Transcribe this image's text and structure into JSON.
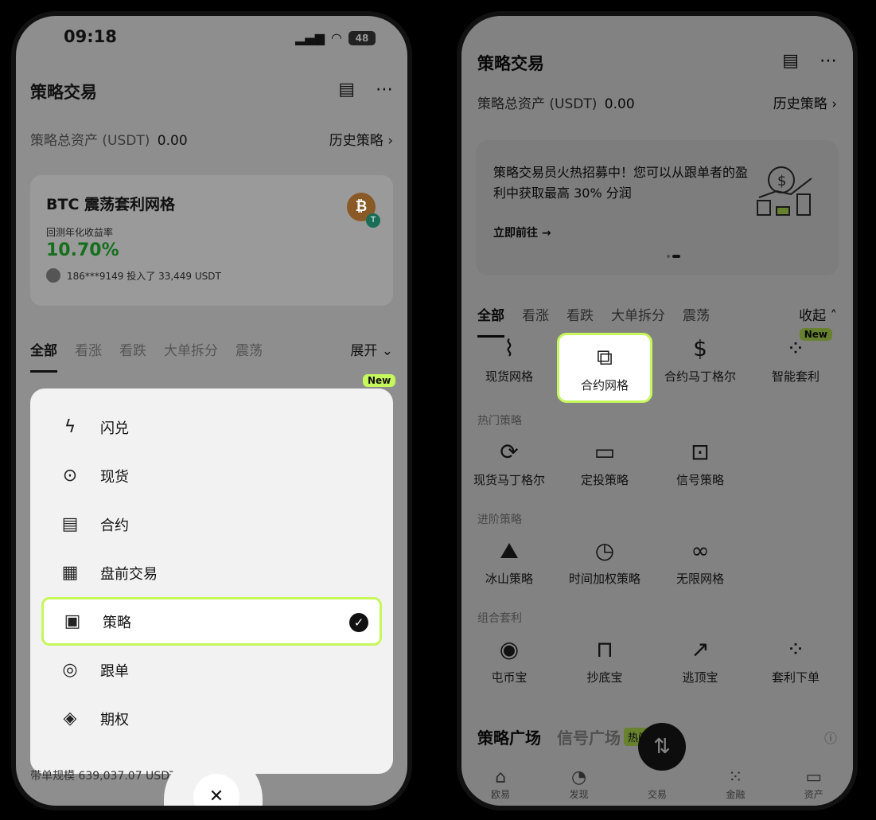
{
  "left": {
    "status": {
      "time": "09:18",
      "battery": "48"
    },
    "title": "策略交易",
    "assets_label": "策略总资产 (USDT)",
    "assets_value": "0.00",
    "history_link": "历史策略",
    "card": {
      "title": "BTC 震荡套利网格",
      "sub": "回测年化收益率",
      "pct": "10.70%",
      "invest": "186***9149 投入了 33,449 USDT"
    },
    "tabs": [
      "全部",
      "看涨",
      "看跌",
      "大单拆分",
      "震荡"
    ],
    "tab_toggle": "展开",
    "menu": [
      {
        "label": "闪兑",
        "icon": "flash-convert-icon"
      },
      {
        "label": "现货",
        "icon": "spot-icon"
      },
      {
        "label": "合约",
        "icon": "futures-icon"
      },
      {
        "label": "盘前交易",
        "icon": "premarket-icon"
      },
      {
        "label": "策略",
        "icon": "bot-icon",
        "selected": true
      },
      {
        "label": "跟单",
        "icon": "copytrade-icon"
      },
      {
        "label": "期权",
        "icon": "options-icon"
      }
    ],
    "footer_text": "带单规模 639,037.07 USDT",
    "new_badge": "New"
  },
  "right": {
    "title": "策略交易",
    "assets_label": "策略总资产 (USDT)",
    "assets_value": "0.00",
    "history_link": "历史策略",
    "promo": {
      "text": "策略交易员火热招募中！您可以从跟单者的盈利中获取最高 30% 分润",
      "link": "立即前往"
    },
    "tabs": [
      "全部",
      "看涨",
      "看跌",
      "大单拆分",
      "震荡"
    ],
    "tab_toggle": "收起",
    "top_grid": [
      "现货网格",
      "合约网格",
      "合约马丁格尔",
      "智能套利"
    ],
    "new_badge": "New",
    "hot_label": "热门策略",
    "hot_grid": [
      "现货马丁格尔",
      "定投策略",
      "信号策略"
    ],
    "adv_label": "进阶策略",
    "adv_grid": [
      "冰山策略",
      "时间加权策略",
      "无限网格"
    ],
    "combo_label": "组合套利",
    "combo_grid": [
      "屯币宝",
      "抄底宝",
      "逃顶宝",
      "套利下单"
    ],
    "plaza": {
      "tab1": "策略广场",
      "tab2": "信号广场",
      "hot": "热门"
    },
    "nav": [
      "欧易",
      "发现",
      "交易",
      "金融",
      "资产"
    ]
  },
  "accent_color": "#c6f75b"
}
